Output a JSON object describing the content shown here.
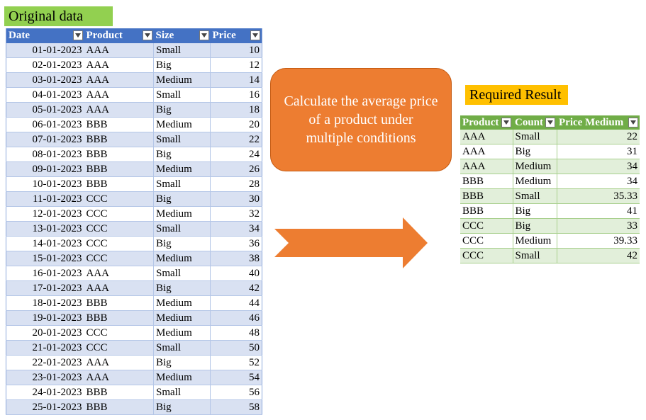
{
  "labels": {
    "original": "Original data",
    "required": "Required Result"
  },
  "callout_text": "Calculate the average price of a product under multiple conditions",
  "source_table": {
    "headers": [
      "Date",
      "Product",
      "Size",
      "Price"
    ],
    "rows": [
      [
        "01-01-2023",
        "AAA",
        "Small",
        "10"
      ],
      [
        "02-01-2023",
        "AAA",
        "Big",
        "12"
      ],
      [
        "03-01-2023",
        "AAA",
        "Medium",
        "14"
      ],
      [
        "04-01-2023",
        "AAA",
        "Small",
        "16"
      ],
      [
        "05-01-2023",
        "AAA",
        "Big",
        "18"
      ],
      [
        "06-01-2023",
        "BBB",
        "Medium",
        "20"
      ],
      [
        "07-01-2023",
        "BBB",
        "Small",
        "22"
      ],
      [
        "08-01-2023",
        "BBB",
        "Big",
        "24"
      ],
      [
        "09-01-2023",
        "BBB",
        "Medium",
        "26"
      ],
      [
        "10-01-2023",
        "BBB",
        "Small",
        "28"
      ],
      [
        "11-01-2023",
        "CCC",
        "Big",
        "30"
      ],
      [
        "12-01-2023",
        "CCC",
        "Medium",
        "32"
      ],
      [
        "13-01-2023",
        "CCC",
        "Small",
        "34"
      ],
      [
        "14-01-2023",
        "CCC",
        "Big",
        "36"
      ],
      [
        "15-01-2023",
        "CCC",
        "Medium",
        "38"
      ],
      [
        "16-01-2023",
        "AAA",
        "Small",
        "40"
      ],
      [
        "17-01-2023",
        "AAA",
        "Big",
        "42"
      ],
      [
        "18-01-2023",
        "BBB",
        "Medium",
        "44"
      ],
      [
        "19-01-2023",
        "BBB",
        "Medium",
        "46"
      ],
      [
        "20-01-2023",
        "CCC",
        "Medium",
        "48"
      ],
      [
        "21-01-2023",
        "CCC",
        "Small",
        "50"
      ],
      [
        "22-01-2023",
        "AAA",
        "Big",
        "52"
      ],
      [
        "23-01-2023",
        "AAA",
        "Medium",
        "54"
      ],
      [
        "24-01-2023",
        "BBB",
        "Small",
        "56"
      ],
      [
        "25-01-2023",
        "BBB",
        "Big",
        "58"
      ]
    ]
  },
  "result_table": {
    "headers": [
      "Product",
      "Count",
      "Price Medium"
    ],
    "rows": [
      [
        "AAA",
        "Small",
        "22"
      ],
      [
        "AAA",
        "Big",
        "31"
      ],
      [
        "AAA",
        "Medium",
        "34"
      ],
      [
        "BBB",
        "Medium",
        "34"
      ],
      [
        "BBB",
        "Small",
        "35.33"
      ],
      [
        "BBB",
        "Big",
        "41"
      ],
      [
        "CCC",
        "Big",
        "33"
      ],
      [
        "CCC",
        "Medium",
        "39.33"
      ],
      [
        "CCC",
        "Small",
        "42"
      ]
    ]
  },
  "colors": {
    "original_label_bg": "#92d050",
    "required_label_bg": "#ffc000",
    "source_header_bg": "#4472c4",
    "source_band_bg": "#d9e1f2",
    "result_header_bg": "#70ad47",
    "result_band_bg": "#e2efda",
    "callout_bg": "#ed7d31",
    "arrow_fill": "#ed7d31"
  },
  "icons": {
    "filter_dropdown": "chevron-down-icon",
    "arrow": "right-arrow-icon"
  }
}
